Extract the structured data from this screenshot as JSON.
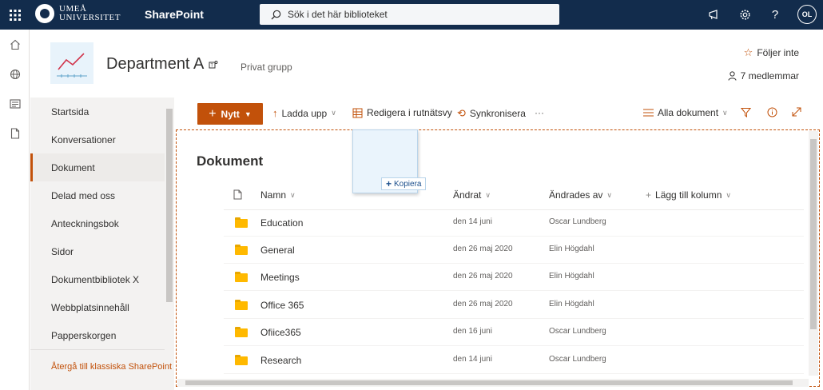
{
  "topbar": {
    "logo_line1": "UMEÅ",
    "logo_line2": "UNIVERSITET",
    "brand": "SharePoint",
    "search_placeholder": "Sök i det här biblioteket",
    "avatar_initials": "OL"
  },
  "site": {
    "title": "Department A",
    "privacy": "Privat grupp",
    "follow": "Följer inte",
    "members": "7 medlemmar"
  },
  "nav": {
    "items": [
      "Startsida",
      "Konversationer",
      "Dokument",
      "Delad med oss",
      "Anteckningsbok",
      "Sidor",
      "Dokumentbibliotek X",
      "Webbplatsinnehåll",
      "Papperskorgen"
    ],
    "active_index": 2,
    "footer": "Återgå till klassiska SharePoint"
  },
  "commands": {
    "new": "Nytt",
    "upload": "Ladda upp",
    "grid_edit": "Redigera i rutnätsvy",
    "sync": "Synkronisera",
    "more": "···",
    "view": "Alla dokument"
  },
  "library": {
    "title": "Dokument",
    "columns": {
      "name": "Namn",
      "modified": "Ändrat",
      "modified_by": "Ändrades av",
      "add_column": "Lägg till kolumn"
    },
    "rows": [
      {
        "name": "Education",
        "modified": "den 14 juni",
        "modified_by": "Oscar Lundberg"
      },
      {
        "name": "General",
        "modified": "den 26 maj 2020",
        "modified_by": "Elin Högdahl"
      },
      {
        "name": "Meetings",
        "modified": "den 26 maj 2020",
        "modified_by": "Elin Högdahl"
      },
      {
        "name": "Office 365",
        "modified": "den 26 maj 2020",
        "modified_by": "Elin Högdahl"
      },
      {
        "name": "Ofiice365",
        "modified": "den 16 juni",
        "modified_by": "Oscar Lundberg"
      },
      {
        "name": "Research",
        "modified": "den 14 juni",
        "modified_by": "Oscar Lundberg"
      }
    ]
  },
  "drag": {
    "copy_label": "Kopiera"
  },
  "colors": {
    "topbar": "#122c4c",
    "accent": "#c2510a",
    "folder": "#ffb900"
  }
}
